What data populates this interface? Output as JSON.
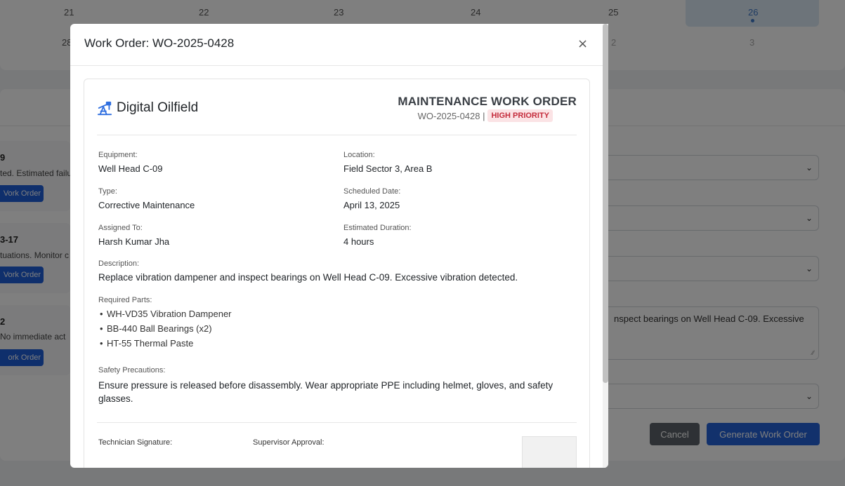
{
  "calendar": {
    "row1": [
      "21",
      "22",
      "23",
      "24",
      "25",
      "26"
    ],
    "row2": [
      "28",
      "2",
      "3"
    ]
  },
  "alerts": [
    {
      "title": "9",
      "text": "ted. Estimated failu",
      "button": "Vork Order"
    },
    {
      "title": "3-17",
      "text": "tuations. Monitor c",
      "button": "Vork Order"
    },
    {
      "title": "2",
      "text": "No immediate act",
      "button": "ork Order"
    }
  ],
  "form": {
    "description_value": "nspect bearings on Well Head C-09. Excessive",
    "cancel_label": "Cancel",
    "generate_label": "Generate Work Order"
  },
  "modal": {
    "title": "Work Order: WO-2025-0428",
    "close_symbol": "×",
    "brand_name": "Digital Oilfield",
    "brand_icon": "oil-pump-icon",
    "heading": "MAINTENANCE WORK ORDER",
    "wo_number": "WO-2025-0428 |",
    "priority": "HIGH PRIORITY",
    "fields": {
      "equipment_label": "Equipment:",
      "equipment_value": "Well Head C-09",
      "location_label": "Location:",
      "location_value": "Field Sector 3, Area B",
      "type_label": "Type:",
      "type_value": "Corrective Maintenance",
      "scheduled_label": "Scheduled Date:",
      "scheduled_value": "April 13, 2025",
      "assigned_label": "Assigned To:",
      "assigned_value": "Harsh Kumar Jha",
      "duration_label": "Estimated Duration:",
      "duration_value": "4 hours"
    },
    "description_label": "Description:",
    "description_value": "Replace vibration dampener and inspect bearings on Well Head C-09. Excessive vibration detected.",
    "parts_label": "Required Parts:",
    "parts": [
      "WH-VD35 Vibration Dampener",
      "BB-440 Ball Bearings (x2)",
      "HT-55 Thermal Paste"
    ],
    "safety_label": "Safety Precautions:",
    "safety_value": "Ensure pressure is released before disassembly. Wear appropriate PPE including helmet, gloves, and safety glasses.",
    "technician_signature_label": "Technician Signature:",
    "supervisor_approval_label": "Supervisor Approval:"
  },
  "colors": {
    "primary": "#2563d8",
    "priority_bg": "#fbe3e5",
    "priority_text": "#c42b3b",
    "brand_icon": "#2f6fe0"
  }
}
